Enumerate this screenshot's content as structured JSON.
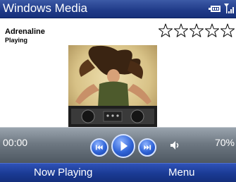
{
  "titlebar": {
    "title": "Windows Media",
    "battery_icon": "battery-icon",
    "signal_icon": "signal-strength-icon"
  },
  "track": {
    "title": "Adrenaline",
    "status": "Playing",
    "rating": 0,
    "max_rating": 5
  },
  "player": {
    "elapsed": "00:00",
    "volume": "70%"
  },
  "softkeys": {
    "left": "Now Playing",
    "right": "Menu"
  },
  "colors": {
    "titlebar": "#1f3a88",
    "softkeys": "#1a3a93",
    "button": "#2f63d6"
  }
}
